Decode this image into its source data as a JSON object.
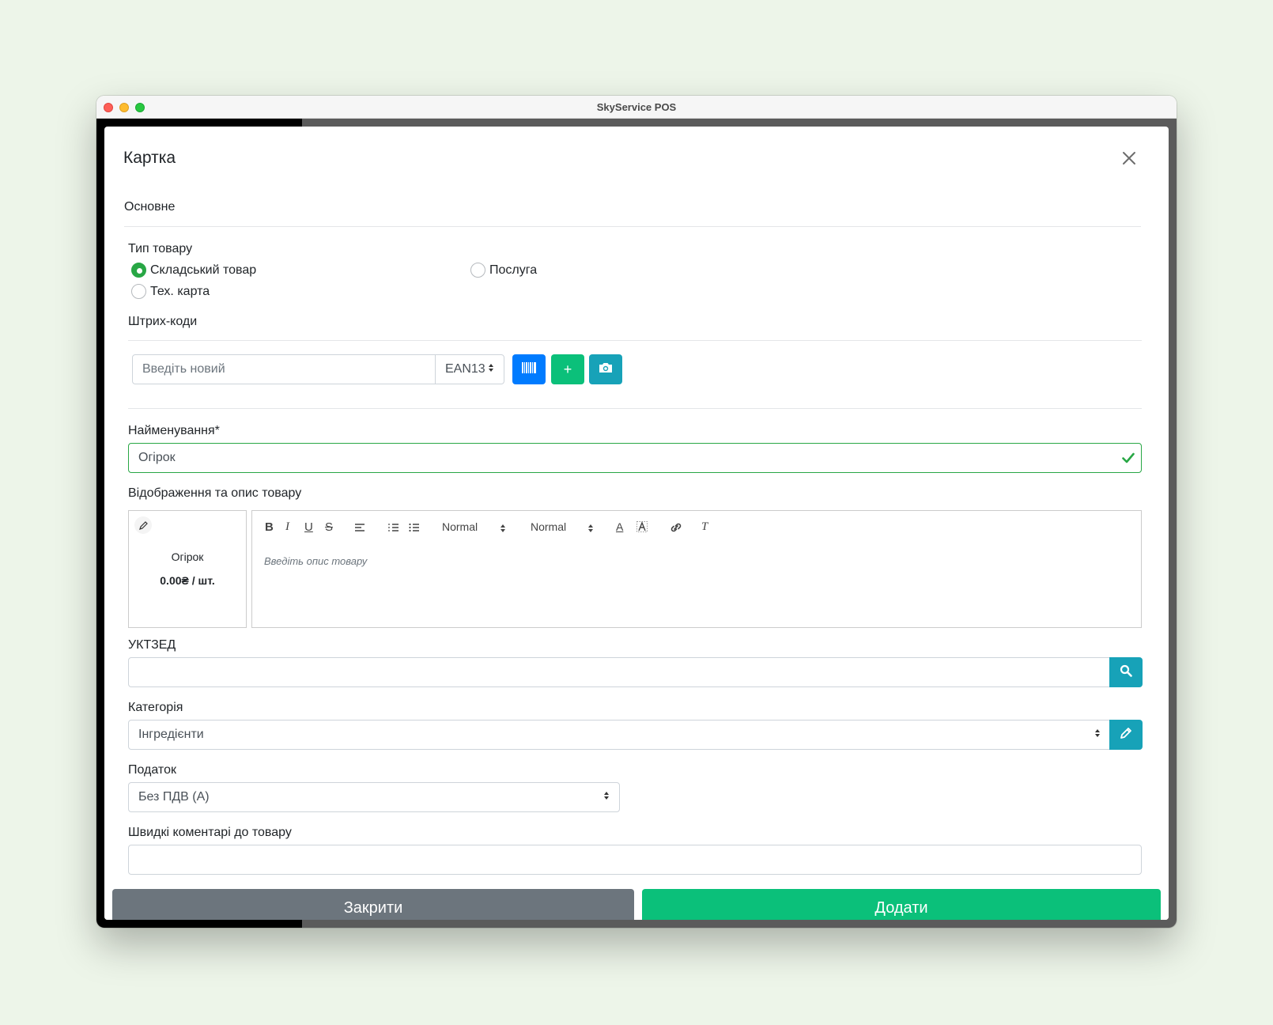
{
  "window": {
    "title": "SkyService POS"
  },
  "modal": {
    "title": "Картка",
    "section_title": "Основне",
    "product_type": {
      "label": "Тип товару",
      "options": [
        "Складський товар",
        "Послуга",
        "Тех. карта"
      ],
      "selected": "Складський товар"
    },
    "barcodes": {
      "label": "Штрих-коди",
      "input_placeholder": "Введіть новий",
      "type_select": "EAN13",
      "add_symbol": "+"
    },
    "name": {
      "label": "Найменування*",
      "value": "Огірок"
    },
    "description": {
      "label": "Відображення та опис товару",
      "preview_name": "Огірок",
      "preview_price": "0.00₴ / шт.",
      "toolbar": {
        "bold": "B",
        "italic": "I",
        "underline": "U",
        "strike": "S",
        "size_select": "Normal",
        "header_select": "Normal",
        "color": "A",
        "clean": "T"
      },
      "placeholder": "Введіть опис товару"
    },
    "uktzed": {
      "label": "УКТЗЕД",
      "value": ""
    },
    "category": {
      "label": "Категорія",
      "value": "Інгредієнти"
    },
    "tax": {
      "label": "Податок",
      "value": "Без ПДВ (А)"
    },
    "quick_comments": {
      "label": "Швидкі коментарі до товару"
    },
    "footer": {
      "close_label": "Закрити",
      "add_label": "Додати"
    }
  },
  "colors": {
    "primary": "#007bff",
    "success": "#28a745",
    "accent_green": "#0bc07a",
    "info": "#17a2b8",
    "secondary": "#6c757d"
  }
}
